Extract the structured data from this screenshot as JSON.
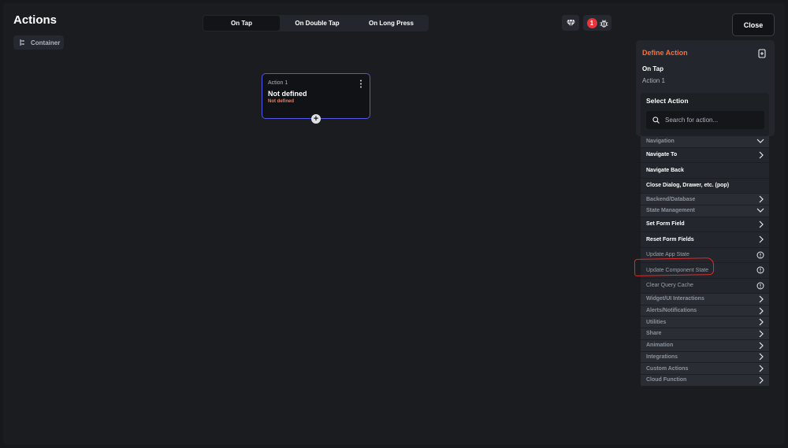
{
  "header": {
    "title": "Actions",
    "chip_label": "Container",
    "tabs": [
      {
        "label": "On Tap",
        "active": true
      },
      {
        "label": "On Double Tap",
        "active": false
      },
      {
        "label": "On Long Press",
        "active": false
      }
    ],
    "issue_count": "1",
    "close_label": "Close"
  },
  "canvas": {
    "node": {
      "label": "Action 1",
      "title": "Not defined",
      "subtitle": "Not defined"
    }
  },
  "define": {
    "title": "Define Action",
    "trigger": "On Tap",
    "action_name": "Action 1"
  },
  "select": {
    "title": "Select Action",
    "search_placeholder": "Search for action...",
    "rows": [
      {
        "type": "cat",
        "label": "Navigation",
        "icon": "chevron-down-icon"
      },
      {
        "type": "item",
        "label": "Navigate To",
        "icon": "chevron-right-icon"
      },
      {
        "type": "item",
        "label": "Navigate Back",
        "icon": ""
      },
      {
        "type": "item",
        "label": "Close Dialog, Drawer, etc. (pop)",
        "icon": ""
      },
      {
        "type": "cat",
        "label": "Backend/Database",
        "icon": "chevron-right-icon"
      },
      {
        "type": "cat",
        "label": "State Management",
        "icon": "chevron-down-icon"
      },
      {
        "type": "item",
        "label": "Set Form Field",
        "icon": "chevron-right-icon"
      },
      {
        "type": "item",
        "label": "Reset Form Fields",
        "icon": "chevron-right-icon"
      },
      {
        "type": "info",
        "label": "Update App State",
        "icon": "info-icon"
      },
      {
        "type": "info",
        "label": "Update Component State",
        "icon": "info-icon"
      },
      {
        "type": "info",
        "label": "Clear Query Cache",
        "icon": "info-icon"
      },
      {
        "type": "cat",
        "label": "Widget/UI Interactions",
        "icon": "chevron-right-icon"
      },
      {
        "type": "cat",
        "label": "Alerts/Notifications",
        "icon": "chevron-right-icon"
      },
      {
        "type": "cat",
        "label": "Utilities",
        "icon": "chevron-right-icon"
      },
      {
        "type": "cat",
        "label": "Share",
        "icon": "chevron-right-icon"
      },
      {
        "type": "cat",
        "label": "Animation",
        "icon": "chevron-right-icon"
      },
      {
        "type": "cat",
        "label": "Integrations",
        "icon": "chevron-right-icon"
      },
      {
        "type": "cat",
        "label": "Custom Actions",
        "icon": "chevron-right-icon"
      },
      {
        "type": "cat",
        "label": "Cloud Function",
        "icon": "chevron-right-icon"
      }
    ]
  },
  "colors": {
    "accent_orange": "#f0743e",
    "node_border": "#5257e6",
    "badge_red": "#e8343c",
    "annotation_red": "#e02a2a"
  }
}
